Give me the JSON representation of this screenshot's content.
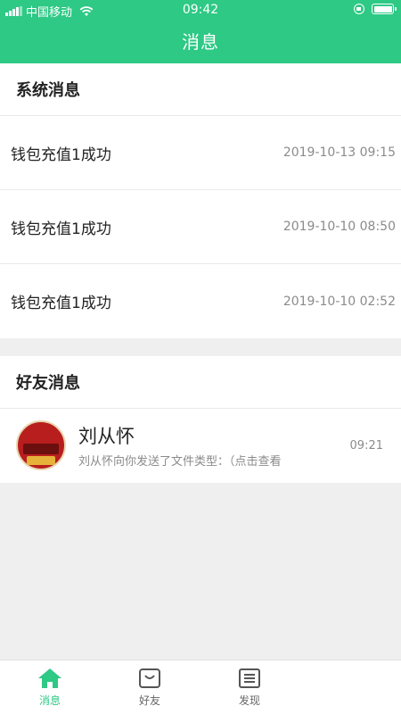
{
  "status_bar": {
    "carrier": "中国移动",
    "time": "09:42"
  },
  "header": {
    "title": "消息"
  },
  "system_section": {
    "title": "系统消息",
    "items": [
      {
        "text": "钱包充值1成功",
        "time": "2019-10-13 09:15"
      },
      {
        "text": "钱包充值1成功",
        "time": "2019-10-10 08:50"
      },
      {
        "text": "钱包充值1成功",
        "time": "2019-10-10 02:52"
      }
    ]
  },
  "friend_section": {
    "title": "好友消息",
    "items": [
      {
        "name": "刘从怀",
        "preview": "刘从怀向你发送了文件类型：（点击查看",
        "time": "09:21"
      }
    ]
  },
  "tabbar": {
    "tabs": [
      {
        "label": "消息",
        "icon": "home-icon",
        "active": true
      },
      {
        "label": "好友",
        "icon": "friends-icon",
        "active": false
      },
      {
        "label": "发现",
        "icon": "discover-icon",
        "active": false
      }
    ]
  },
  "colors": {
    "accent": "#2dc985",
    "background": "#efefef",
    "secondary_text": "#8b8b8b"
  }
}
